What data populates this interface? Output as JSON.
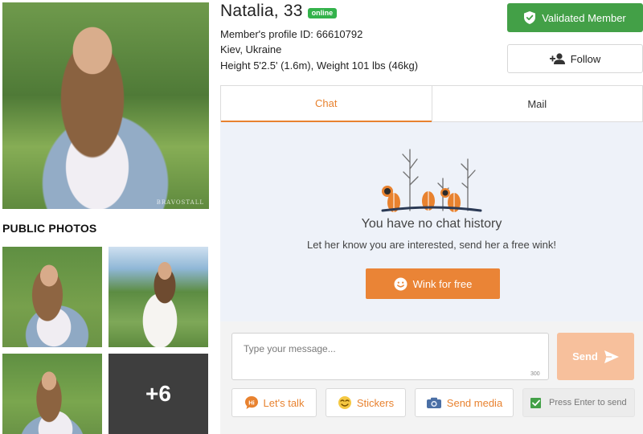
{
  "profile": {
    "name": "Natalia, 33",
    "status_badge": "online",
    "member_id": "Member's profile ID: 66610792",
    "location": "Kiev, Ukraine",
    "measurements": "Height 5'2.5' (1.6m), Weight 101 lbs (46kg)"
  },
  "actions": {
    "validated_label": "Validated Member",
    "follow_label": "Follow"
  },
  "photos": {
    "section_title": "PUBLIC PHOTOS",
    "more_count": "+6",
    "watermark": "BRAVOSTALL"
  },
  "tabs": [
    {
      "label": "Chat",
      "active": true
    },
    {
      "label": "Mail",
      "active": false
    }
  ],
  "chat_empty": {
    "title": "You have no chat history",
    "subtitle": "Let her know you are interested, send her a free wink!",
    "wink_label": "Wink for free"
  },
  "composer": {
    "placeholder": "Type your message...",
    "char_limit": "300",
    "send_label": "Send",
    "quick_actions": [
      {
        "label": "Let's talk",
        "icon": "hi-bubble-icon"
      },
      {
        "label": "Stickers",
        "icon": "sticker-emoji-icon"
      },
      {
        "label": "Send media",
        "icon": "camera-icon"
      }
    ],
    "press_enter_label": "Press Enter to send",
    "press_enter_checked": true
  },
  "colors": {
    "accent_orange": "#ea8436",
    "validated_green": "#43a047",
    "online_green": "#33b24b",
    "chat_bg": "#eef2f9"
  }
}
